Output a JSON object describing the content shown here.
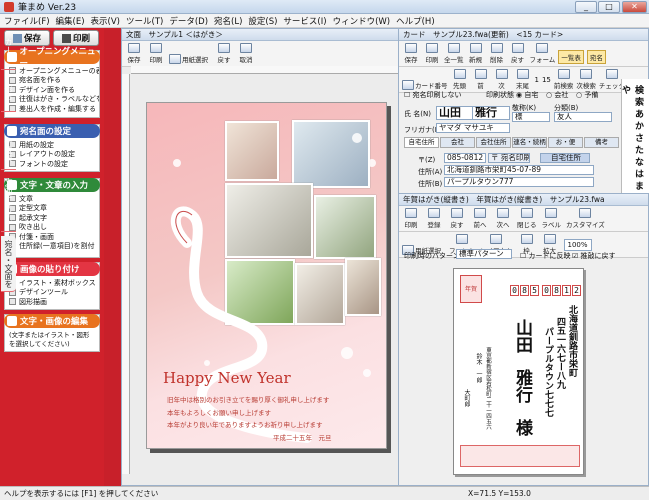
{
  "app": {
    "title": "筆まめ Ver.23",
    "minimize": "_",
    "maximize": "□",
    "close": "✕"
  },
  "menu": [
    "ファイル(F)",
    "編集(E)",
    "表示(V)",
    "ツール(T)",
    "データ(D)",
    "宛名(L)",
    "設定(S)",
    "サービス(I)",
    "ウィンドウ(W)",
    "ヘルプ(H)"
  ],
  "left_top": {
    "save_label": "保存",
    "print_label": "印刷"
  },
  "sections": [
    {
      "title": "オープニングメニュー",
      "color": "#e8731f",
      "items": [
        "オープニングメニューの表示",
        "宛名面を作る",
        "デザイン面を作る",
        "往復はがき・ラベルなどを作る",
        "差出人を作成・編集する"
      ]
    },
    {
      "title": "宛名面の設定",
      "color": "#e33543",
      "items": [
        "用紙の設定",
        "レイアウトの設定",
        "フォントの設定"
      ]
    },
    {
      "title": "文字・文章の入力",
      "color": "#2f8a3a",
      "items": [
        "文章",
        "定型文章",
        "起承文字",
        "吹き出し",
        "付箋・画面",
        "住所録(一意項目)を割付"
      ]
    },
    {
      "title": "画像の貼り付け",
      "color": "#e33543",
      "items": [
        "イラスト・素材ボックス",
        "デザインツール",
        "図形描画"
      ]
    },
    {
      "title": "文字・画像の編集",
      "color": "#e8731f",
      "items": [
        "(文字またはイラスト・図形を選択してください)"
      ]
    }
  ],
  "vtabs": [
    "カード",
    "宛名",
    "一覧表",
    "文面デザイン",
    "宛名・文面を"
  ],
  "doc_window": {
    "title": "文面　サンプル1 ＜はがき＞",
    "toolbar": [
      "保存",
      "印刷",
      "用紙選択",
      "戻す",
      "取消"
    ],
    "card": {
      "heading": "Happy New Year",
      "lines": [
        "旧年中は格別のお引き立てを賜り厚く御礼申し上げます",
        "本年もよろしくお願い申し上げます",
        "昨年はいろいろとお世話になりました",
        "本年がより良い年でありますようお祈り申し上げます"
      ],
      "date": "平成二十五年　元旦"
    }
  },
  "card_window": {
    "title": "カード　サンプル23.fwa(更新)　<15 カード>",
    "toolbar": [
      "保存",
      "印刷",
      "全一覧",
      "新規",
      "削除",
      "戻す",
      "フォーム",
      "一覧表",
      "宛名"
    ],
    "toolbar2": [
      "カード番号",
      "先頭",
      "前",
      "次",
      "末尾",
      "1",
      "15",
      "前検索",
      "次検索",
      "チェック"
    ],
    "fields": {
      "checkbox_label": "宛名印刷しない",
      "print_state_label": "印刷状態",
      "print_options": [
        "自宅",
        "会社",
        "予備"
      ],
      "name_label": "氏 名(N)",
      "surname": "山田",
      "given": "雅行",
      "furigana_label": "フリガナ(F)",
      "furigana": "ヤマダ マサユキ",
      "honorific_label": "敬称(K)",
      "honorific": "様",
      "category_label": "分類(B)",
      "category": "友人",
      "tabs": [
        "自宅住所",
        "会社",
        "会社住所",
        "連名・続柄",
        "お・便",
        "備考"
      ],
      "zip_label": "〒(Z)",
      "zip": "085-0812",
      "zip_btn": "〒 宛名印刷",
      "home_btn": "自宅住所",
      "addr1_label": "住所(A)",
      "addr1": "北海道釧路市栄町45-07-89",
      "addr2_label": "住所(B)",
      "addr2": "パープルタウン777"
    },
    "kana_index": "検索あかさたなはまや"
  },
  "postcard_window": {
    "title": "年賀はがき(縦書き)　年賀はがき(縦書き)　サンプル23.fwa",
    "toolbar": [
      "印刷",
      "登録",
      "戻す",
      "前へ",
      "次へ",
      "閉じる",
      "ラベル",
      "カスタマイズ"
    ],
    "toolbar2": [
      "用紙選択",
      "フォント",
      "レイアウト",
      "枠",
      "拡大",
      "100%"
    ],
    "pattern_label": "印刷時のパターン",
    "pattern_value": "標準パターン",
    "opt1": "カードに反映",
    "opt2": "推敲に戻す",
    "zip_digits": [
      "0",
      "8",
      "5",
      "0",
      "8",
      "1",
      "2"
    ],
    "address": "北海道釧路市栄町",
    "address2": "四五一六七ー八九",
    "address3": "パープルタウン七七七",
    "surname": "山田",
    "given": "雅行",
    "honorific": "様",
    "sender_address": "東京都新宿区若松町二十一四五六",
    "sender_name": "鈴木　一郎",
    "sender_bottom": "大町郎",
    "stamp_text": "年賀"
  },
  "status": {
    "help": "ヘルプを表示するには [F1] を押してください",
    "coords": "X=71.5 Y=153.0"
  }
}
